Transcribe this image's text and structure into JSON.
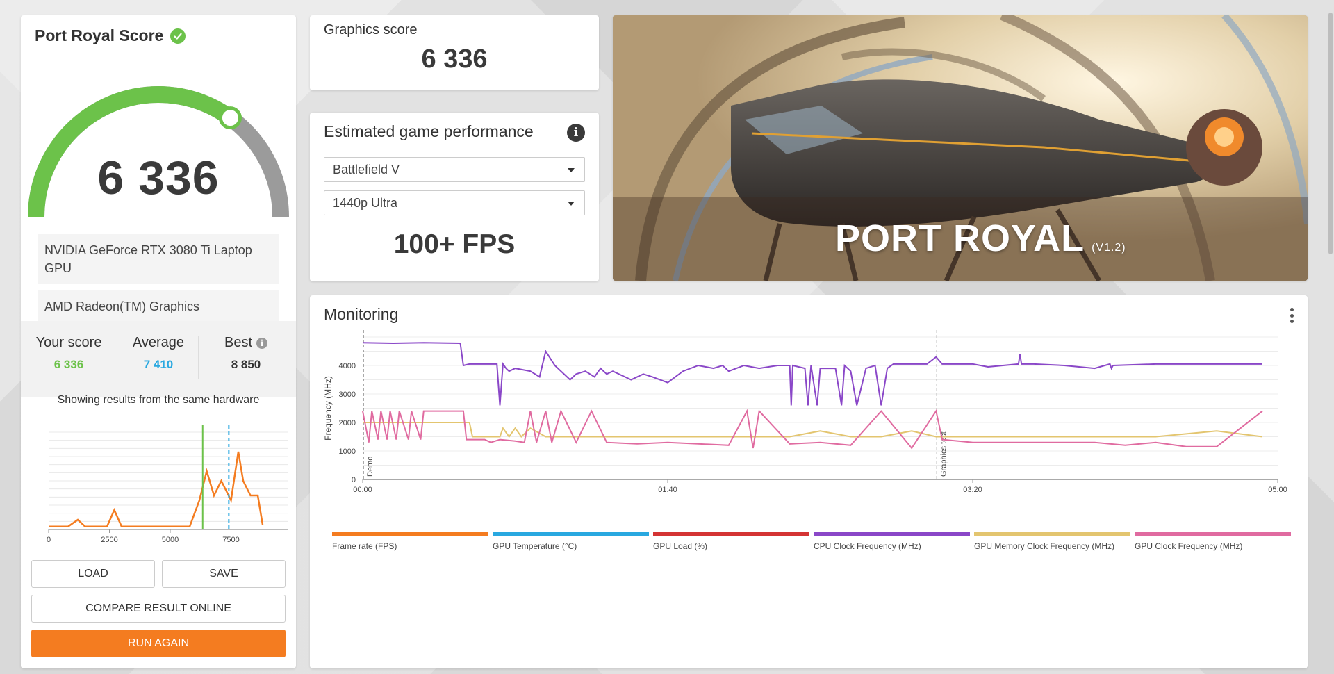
{
  "score_card": {
    "title": "Port Royal Score",
    "score": "6 336",
    "gauge_fraction": 0.7,
    "hardware": [
      "NVIDIA GeForce RTX 3080 Ti Laptop GPU",
      "AMD Radeon(TM) Graphics"
    ],
    "stats": {
      "your_score_label": "Your score",
      "your_score": "6 336",
      "average_label": "Average",
      "average": "7 410",
      "best_label": "Best",
      "best": "8 850"
    },
    "same_hw_text": "Showing results from the same hardware",
    "buttons": {
      "load": "LOAD",
      "save": "SAVE",
      "compare": "COMPARE RESULT ONLINE",
      "run": "RUN AGAIN"
    }
  },
  "graphics_score": {
    "label": "Graphics score",
    "value": "6 336"
  },
  "estimated": {
    "title": "Estimated game performance",
    "game": "Battlefield V",
    "preset": "1440p Ultra",
    "fps": "100+ FPS"
  },
  "banner": {
    "title": "PORT ROYAL",
    "version": "(V1.2)"
  },
  "monitoring": {
    "title": "Monitoring"
  },
  "colors": {
    "green": "#6cc24a",
    "blue": "#29a8e0",
    "orange": "#f47c20",
    "gray_arc": "#9b9b9b",
    "purple": "#8a47c8",
    "pink": "#e06ba0",
    "yellow": "#e3c56f",
    "red": "#d43434"
  },
  "chart_data": [
    {
      "type": "line",
      "title": "",
      "xlabel": "",
      "ylabel": "",
      "x_ticks": [
        "0",
        "2500",
        "5000",
        "7500"
      ],
      "xlim": [
        0,
        10000
      ],
      "series": [
        {
          "x": [
            0,
            800,
            1200,
            1500,
            2400,
            2700,
            3000,
            5800,
            6200,
            6500,
            6800,
            7100,
            7500,
            7800,
            8000,
            8300,
            8600,
            8800
          ],
          "y": [
            0.03,
            0.03,
            0.1,
            0.03,
            0.03,
            0.2,
            0.03,
            0.03,
            0.3,
            0.6,
            0.35,
            0.5,
            0.3,
            0.8,
            0.5,
            0.35,
            0.35,
            0.05
          ]
        }
      ],
      "markers": [
        {
          "x": 6336,
          "color": "#6cc24a"
        },
        {
          "x": 7410,
          "color": "#29a8e0",
          "dashed": true
        }
      ]
    },
    {
      "type": "line",
      "title": "",
      "ylabel": "Frequency (MHz)",
      "xlabel": "",
      "y_ticks": [
        0,
        1000,
        2000,
        3000,
        4000
      ],
      "ylim": [
        0,
        5000
      ],
      "x_ticks": [
        "00:00",
        "01:40",
        "03:20",
        "05:00"
      ],
      "xlim": [
        0,
        300
      ],
      "annotations": [
        {
          "x": 0,
          "text": "Demo"
        },
        {
          "x": 188,
          "text": "Graphics test"
        }
      ],
      "legend": [
        "Frame rate (FPS)",
        "GPU Temperature (°C)",
        "GPU Load (%)",
        "CPU Clock Frequency (MHz)",
        "GPU Memory Clock Frequency (MHz)",
        "GPU Clock Frequency (MHz)"
      ],
      "legend_colors": [
        "#f47c20",
        "#29a8e0",
        "#d43434",
        "#8a47c8",
        "#e3c56f",
        "#e06ba0"
      ],
      "series": [
        {
          "name": "CPU Clock Frequency (MHz)",
          "x": [
            0,
            10,
            20,
            32,
            33,
            35,
            44,
            45,
            46,
            47,
            48,
            50,
            55,
            58,
            60,
            63,
            68,
            70,
            73,
            76,
            78,
            80,
            82,
            88,
            92,
            95,
            100,
            105,
            110,
            115,
            118,
            120,
            125,
            130,
            136,
            140,
            140.5,
            141,
            145,
            146,
            147,
            149,
            150,
            155,
            157,
            158,
            160,
            162,
            165,
            168,
            170,
            172,
            174,
            176,
            178,
            185,
            188,
            190,
            200,
            205,
            215,
            215.5,
            216,
            220,
            230,
            240,
            245,
            245.5,
            246,
            260,
            275,
            280,
            295
          ],
          "y": [
            4800,
            4780,
            4800,
            4780,
            4000,
            4050,
            4050,
            2600,
            4050,
            3900,
            3800,
            3900,
            3800,
            3600,
            4500,
            4000,
            3500,
            3700,
            3800,
            3600,
            3900,
            3700,
            3800,
            3500,
            3700,
            3600,
            3400,
            3800,
            4000,
            3900,
            4000,
            3800,
            4000,
            3900,
            4000,
            4000,
            2600,
            4000,
            3900,
            2600,
            4000,
            2600,
            3900,
            3900,
            2600,
            4000,
            3800,
            2600,
            3900,
            4000,
            2600,
            3900,
            4050,
            4050,
            4050,
            4050,
            4300,
            4050,
            4050,
            3950,
            4050,
            4400,
            4050,
            4050,
            4000,
            3900,
            4050,
            3900,
            4000,
            4050,
            4050,
            4050,
            4050
          ]
        },
        {
          "name": "GPU Memory Clock Frequency (MHz)",
          "x": [
            0,
            35,
            36,
            45,
            46,
            48,
            50,
            52,
            55,
            60,
            70,
            80,
            90,
            100,
            120,
            140,
            150,
            160,
            170,
            180,
            188,
            190,
            200,
            220,
            240,
            260,
            280,
            295
          ],
          "y": [
            2000,
            2000,
            1500,
            1500,
            1800,
            1500,
            1800,
            1500,
            1800,
            1500,
            1500,
            1500,
            1500,
            1500,
            1500,
            1500,
            1700,
            1500,
            1500,
            1700,
            1500,
            1500,
            1500,
            1500,
            1500,
            1500,
            1700,
            1500
          ]
        },
        {
          "name": "GPU Clock Frequency (MHz)",
          "x": [
            0,
            2,
            3,
            5,
            6,
            8,
            9,
            11,
            12,
            15,
            16,
            19,
            20,
            33,
            34,
            40,
            42,
            45,
            50,
            53,
            55,
            57,
            60,
            62,
            65,
            70,
            75,
            80,
            90,
            100,
            110,
            120,
            126,
            128,
            130,
            140,
            150,
            160,
            170,
            180,
            188,
            190,
            200,
            210,
            220,
            230,
            240,
            250,
            260,
            270,
            280,
            295
          ],
          "y": [
            2400,
            1300,
            2400,
            1400,
            2400,
            1400,
            2400,
            1400,
            2400,
            1400,
            2400,
            1400,
            2400,
            2400,
            1400,
            1400,
            1300,
            1400,
            1350,
            1300,
            2400,
            1300,
            2400,
            1300,
            2400,
            1300,
            2400,
            1300,
            1250,
            1300,
            1250,
            1200,
            2400,
            1100,
            2400,
            1250,
            1300,
            1200,
            2400,
            1100,
            2400,
            1400,
            1300,
            1300,
            1300,
            1300,
            1300,
            1200,
            1300,
            1150,
            1150,
            2400
          ]
        }
      ]
    }
  ]
}
